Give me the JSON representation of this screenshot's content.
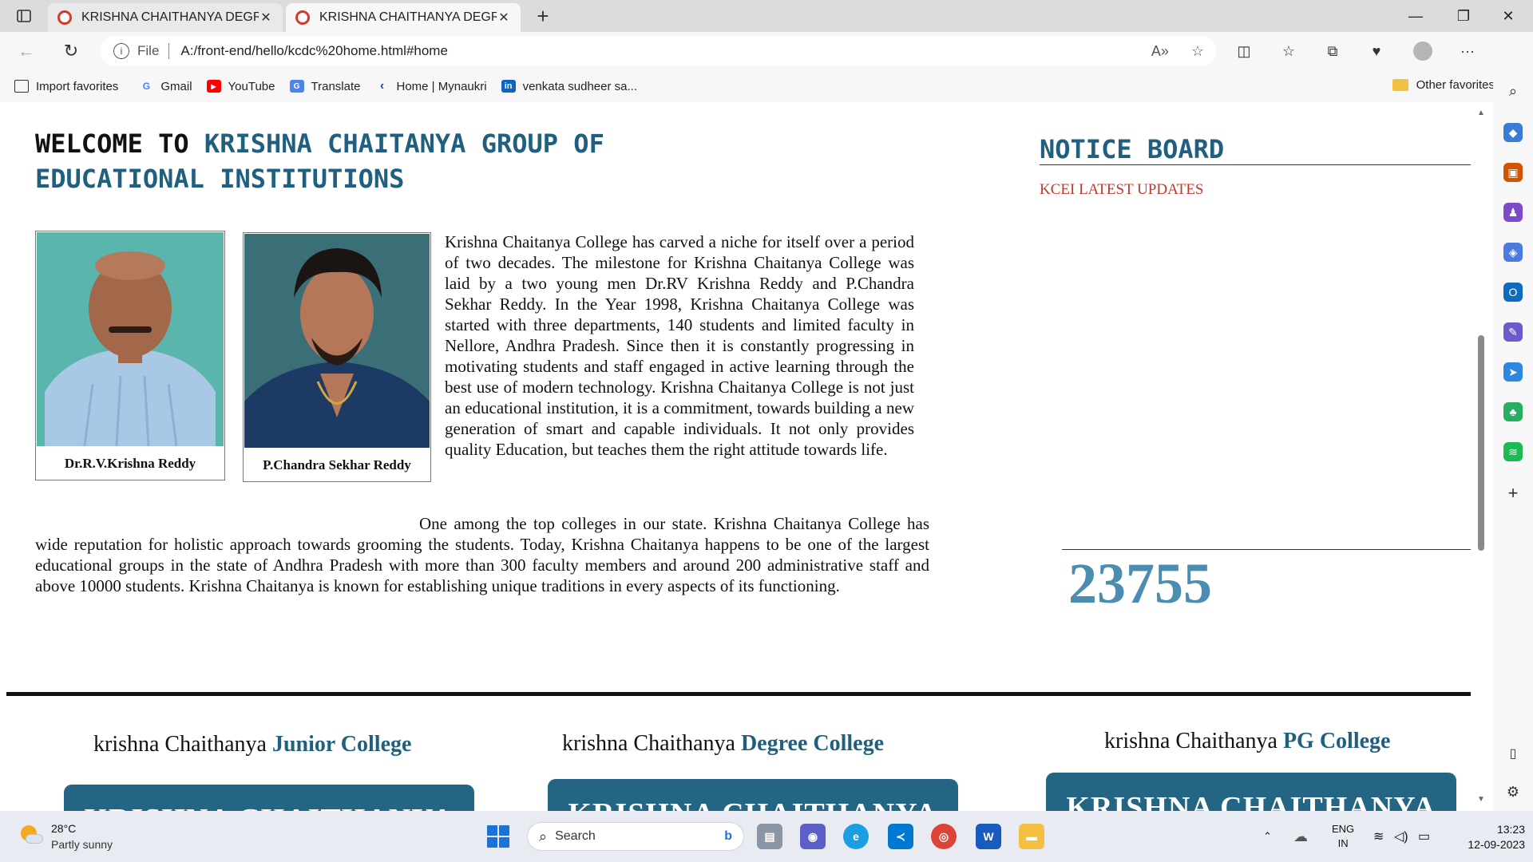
{
  "browser": {
    "tabs": [
      {
        "title": "KRISHNA CHAITHANYA DEGREE",
        "active": false
      },
      {
        "title": "KRISHNA CHAITHANYA DEGREE",
        "active": true
      }
    ],
    "address": {
      "scheme_label": "File",
      "url": "A:/front-end/hello/kcdc%20home.html#home"
    },
    "bookmarks": [
      {
        "label": "Import favorites",
        "icon": "import-icon"
      },
      {
        "label": "Gmail",
        "icon": "google-icon"
      },
      {
        "label": "YouTube",
        "icon": "youtube-icon"
      },
      {
        "label": "Translate",
        "icon": "translate-icon"
      },
      {
        "label": "Home | Mynaukri",
        "icon": "mynaukri-icon"
      },
      {
        "label": "venkata sudheer sa...",
        "icon": "linkedin-icon"
      }
    ],
    "other_favorites": "Other favorites"
  },
  "page": {
    "welcome_lead": "WELCOME TO",
    "welcome_name": "KRISHNA CHAITANYA GROUP OF EDUCATIONAL INSTITUTIONS",
    "founders": [
      {
        "name": "Dr.R.V.Krishna Reddy"
      },
      {
        "name": "P.Chandra Sekhar Reddy"
      }
    ],
    "intro": "Krishna Chaitanya College has carved a niche for itself over a period of two decades. The milestone for Krishna Chaitanya College was laid by a two young men Dr.RV Krishna Reddy and P.Chandra Sekhar Reddy. In the Year 1998, Krishna Chaitanya College was started with three departments, 140 students and limited faculty in Nellore, Andhra Pradesh. Since then it is constantly progressing in motivating students and staff engaged in active learning through the best use of modern technology. Krishna Chaitanya College is not just an educational institution, it is a commitment, towards building a new generation of smart and capable individuals. It not only provides quality Education, but teaches them the right attitude towards life.",
    "second": "One among the top colleges in our state. Krishna Chaitanya College has wide reputation for holistic approach towards grooming the students. Today, Krishna Chaitanya happens to be one of the largest educational groups in the state of Andhra Pradesh with more than 300 faculty members and around 200 administrative staff and above 10000 students. Krishna Chaitanya is known for establishing unique traditions in every aspects of its functioning.",
    "notice": {
      "title": "NOTICE BOARD",
      "subtitle": "KCEI LATEST UPDATES",
      "counter": "23755"
    },
    "colleges": [
      {
        "prefix": "krishna Chaithanya",
        "highlight": "Junior College",
        "card": "KRISHNA CHAITHANYA"
      },
      {
        "prefix": "krishna Chaithanya",
        "highlight": "Degree College",
        "card": "KRISHNA CHAITHANYA"
      },
      {
        "prefix": "krishna Chaithanya",
        "highlight": "PG College",
        "card": "KRISHNA CHAITHANYA"
      }
    ]
  },
  "taskbar": {
    "weather_temp": "28°C",
    "weather_desc": "Partly sunny",
    "search_placeholder": "Search",
    "lang_top": "ENG",
    "lang_bottom": "IN",
    "time": "13:23",
    "date": "12-09-2023"
  },
  "colors": {
    "accent": "#1f6080",
    "notice_red": "#c0392b",
    "counter": "#4a8db0",
    "card": "#236583"
  }
}
